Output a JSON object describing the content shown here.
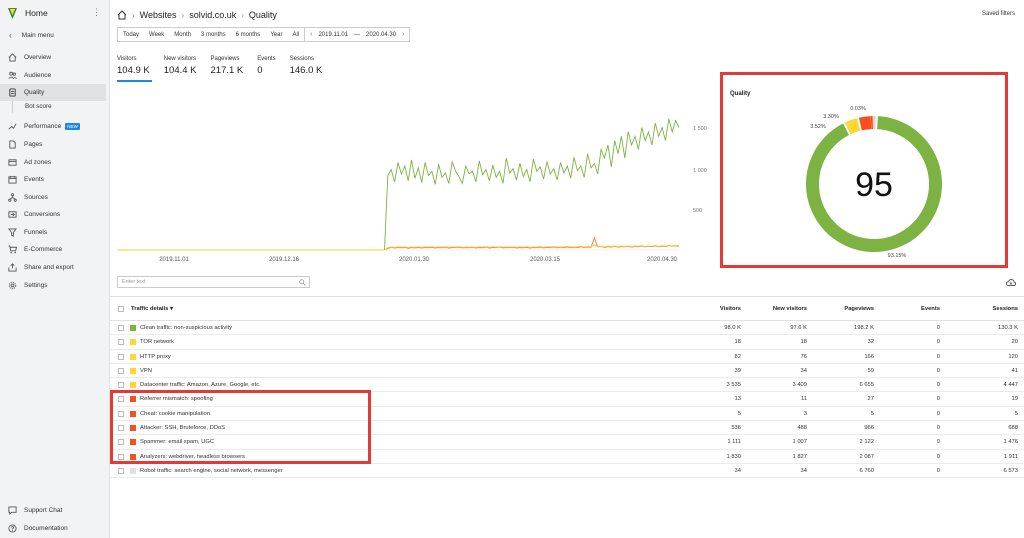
{
  "sidebar": {
    "home": "Home",
    "main_menu": "Main menu",
    "items": [
      "Overview",
      "Audience",
      "Quality",
      "Performance",
      "Pages",
      "Ad zones",
      "Events",
      "Sources",
      "Conversions",
      "Funnels",
      "E-Commerce",
      "Share and export",
      "Settings"
    ],
    "sub_item": "Bot score",
    "new_badge": "NEW",
    "support": "Support Chat",
    "docs": "Documentation"
  },
  "header": {
    "crumbs": [
      "Websites",
      "solvid.co.uk",
      "Quality"
    ],
    "saved_filters": "Saved filters"
  },
  "periods": [
    "Today",
    "Week",
    "Month",
    "3 months",
    "6 months",
    "Year",
    "All"
  ],
  "range": {
    "from": "2019.11.01",
    "dash": "—",
    "to": "2020.04.30"
  },
  "metrics": [
    {
      "label": "Visitors",
      "value": "104.9 K"
    },
    {
      "label": "New visitors",
      "value": "104.4 K"
    },
    {
      "label": "Pageviews",
      "value": "217.1 K"
    },
    {
      "label": "Events",
      "value": "0"
    },
    {
      "label": "Sessions",
      "value": "146.0 K"
    }
  ],
  "chart_data": [
    {
      "type": "line",
      "x_ticks": [
        "2019.11.01",
        "2019.12.16",
        "2020.01.30",
        "2020.03.15",
        "2020.04.30"
      ],
      "y_ticks": [
        "1 500",
        "1 000",
        "500"
      ],
      "ylim": [
        0,
        1600
      ],
      "series": [
        {
          "color": "#7cb342",
          "values": [
            0,
            0,
            0,
            0,
            0,
            0,
            0,
            0,
            0,
            0,
            0,
            0,
            0,
            0,
            0,
            0,
            0,
            0,
            0,
            0,
            0,
            0,
            0,
            0,
            0,
            0,
            0,
            0,
            0,
            0,
            0,
            0,
            0,
            0,
            0,
            0,
            0,
            0,
            0,
            0,
            0,
            0,
            0,
            0,
            0,
            0,
            0,
            0,
            0,
            0,
            0,
            0,
            0,
            0,
            0,
            0,
            0,
            0,
            0,
            0,
            0,
            0,
            0,
            0,
            0,
            0,
            0,
            0,
            0,
            0,
            0,
            0,
            0,
            0,
            0,
            0,
            0,
            0,
            0,
            0,
            850,
            920,
            780,
            1000,
            870,
            960,
            790,
            1030,
            820,
            940,
            770,
            1000,
            850,
            900,
            750,
            980,
            830,
            880,
            760,
            1010,
            900,
            840,
            760,
            960,
            870,
            900,
            780,
            1020,
            860,
            920,
            790,
            970,
            830,
            900,
            760,
            1050,
            880,
            930,
            800,
            990,
            840,
            920,
            780,
            1040,
            900,
            950,
            810,
            1010,
            870,
            930,
            800,
            1000,
            880,
            960,
            820,
            1060,
            910,
            960,
            830,
            1100,
            940,
            990,
            870,
            1150,
            1050,
            1200,
            950,
            1250,
            1100,
            1300,
            1050,
            1350,
            1200,
            1300,
            1150,
            1400,
            1250,
            1350,
            1200,
            1450,
            1300,
            1400,
            1250,
            1500,
            1350,
            1480,
            1400
          ]
        },
        {
          "color": "#ff7043",
          "values": [
            0,
            0,
            0,
            0,
            0,
            0,
            0,
            0,
            0,
            0,
            0,
            0,
            0,
            0,
            0,
            0,
            0,
            0,
            0,
            0,
            0,
            0,
            0,
            0,
            0,
            0,
            0,
            0,
            0,
            0,
            0,
            0,
            0,
            0,
            0,
            0,
            0,
            0,
            0,
            0,
            0,
            0,
            0,
            0,
            0,
            0,
            0,
            0,
            0,
            0,
            0,
            0,
            0,
            0,
            0,
            0,
            0,
            0,
            0,
            0,
            0,
            0,
            0,
            0,
            0,
            0,
            0,
            0,
            0,
            0,
            0,
            0,
            0,
            0,
            0,
            0,
            0,
            0,
            0,
            0,
            20,
            30,
            22,
            28,
            25,
            32,
            20,
            27,
            24,
            30,
            22,
            29,
            26,
            31,
            23,
            28,
            25,
            33,
            22,
            30,
            27,
            32,
            24,
            29,
            26,
            31,
            23,
            28,
            25,
            34,
            22,
            30,
            27,
            33,
            24,
            29,
            26,
            31,
            23,
            28,
            25,
            30,
            22,
            29,
            26,
            32,
            24,
            30,
            27,
            33,
            25,
            31,
            28,
            35,
            26,
            32,
            29,
            36,
            27,
            33,
            30,
            140,
            35,
            40,
            30,
            38,
            34,
            42,
            32,
            39,
            36,
            44,
            33,
            40,
            37,
            46,
            35,
            42,
            38,
            48,
            36,
            44,
            40,
            50,
            45,
            48,
            44
          ]
        },
        {
          "color": "#ffca28",
          "values": [
            0,
            0,
            0,
            0,
            0,
            0,
            0,
            0,
            0,
            0,
            0,
            0,
            0,
            0,
            0,
            0,
            0,
            0,
            0,
            0,
            0,
            0,
            0,
            0,
            0,
            0,
            0,
            0,
            0,
            0,
            0,
            0,
            0,
            0,
            0,
            0,
            0,
            0,
            0,
            0,
            0,
            0,
            0,
            0,
            0,
            0,
            0,
            0,
            0,
            0,
            0,
            0,
            0,
            0,
            0,
            0,
            0,
            0,
            0,
            0,
            0,
            0,
            0,
            0,
            0,
            0,
            0,
            0,
            0,
            0,
            0,
            0,
            0,
            0,
            0,
            0,
            0,
            0,
            0,
            0,
            28,
            34,
            30,
            36,
            32,
            38,
            29,
            35,
            31,
            37,
            30,
            36,
            33,
            38,
            31,
            35,
            32,
            39,
            30,
            36,
            33,
            38,
            31,
            35,
            32,
            37,
            30,
            36,
            33,
            39,
            31,
            36,
            33,
            38,
            32,
            35,
            33,
            37,
            31,
            36,
            32,
            38,
            30,
            35,
            33,
            39,
            31,
            36,
            34,
            40,
            32,
            37,
            35,
            42,
            33,
            38,
            36,
            44,
            34,
            40,
            37,
            60,
            38,
            42,
            36,
            44,
            40,
            46,
            38,
            45,
            41,
            48,
            39,
            46,
            42,
            50,
            40,
            47,
            43,
            52,
            41,
            49,
            45,
            54,
            48,
            52,
            50
          ]
        }
      ]
    },
    {
      "type": "pie",
      "title": "Quality",
      "center_value": "95",
      "slices": [
        {
          "label": "93.15%",
          "value": 93.15,
          "color": "#7cb342"
        },
        {
          "label": "3.52%",
          "value": 3.52,
          "color": "#fdd835"
        },
        {
          "label": "3.30%",
          "value": 3.3,
          "color": "#f4511e"
        },
        {
          "label": "0.03%",
          "value": 0.03,
          "color": "#f4511e"
        },
        {
          "label": "",
          "value": 1.2,
          "color": "#d6d6d6"
        }
      ]
    }
  ],
  "filter": {
    "placeholder": "Enter text"
  },
  "table": {
    "headers": [
      "Traffic details",
      "Visitors",
      "New visitors",
      "Pageviews",
      "Events",
      "Sessions"
    ],
    "rows": [
      {
        "color": "#7cb342",
        "cells": [
          "Clean traffic: non-suspicious activity",
          "98.0 K",
          "97.6 K",
          "198.2 K",
          "0",
          "130.3 K"
        ]
      },
      {
        "color": "#fdd835",
        "cells": [
          "TOR network",
          "18",
          "18",
          "32",
          "0",
          "20"
        ]
      },
      {
        "color": "#fdd835",
        "cells": [
          "HTTP proxy",
          "82",
          "76",
          "166",
          "0",
          "120"
        ]
      },
      {
        "color": "#fdd835",
        "cells": [
          "VPN",
          "39",
          "34",
          "59",
          "0",
          "41"
        ]
      },
      {
        "color": "#fdd835",
        "cells": [
          "Datacenter traffic: Amazon, Azure, Google, etc.",
          "3 535",
          "3 409",
          "6 655",
          "0",
          "4 447"
        ]
      },
      {
        "color": "#f4511e",
        "cells": [
          "Referrer mismatch: spoofing",
          "13",
          "11",
          "27",
          "0",
          "19"
        ]
      },
      {
        "color": "#f4511e",
        "cells": [
          "Cheat: cookie manipulation",
          "5",
          "3",
          "5",
          "0",
          "5"
        ]
      },
      {
        "color": "#f4511e",
        "cells": [
          "Attacker: SSH, Bruteforce, DDoS",
          "536",
          "488",
          "966",
          "0",
          "688"
        ]
      },
      {
        "color": "#f4511e",
        "cells": [
          "Spammer: email spam, UGC",
          "1 111",
          "1 007",
          "2 122",
          "0",
          "1 476"
        ]
      },
      {
        "color": "#f4511e",
        "cells": [
          "Analyzers: webdriver, headless browsers",
          "1 830",
          "1 827",
          "2 087",
          "0",
          "1 911"
        ]
      },
      {
        "color": "#e0e0e0",
        "cells": [
          "Robot traffic: search engine, social network, messenger",
          "34",
          "34",
          "6 760",
          "0",
          "6 573"
        ]
      }
    ]
  }
}
